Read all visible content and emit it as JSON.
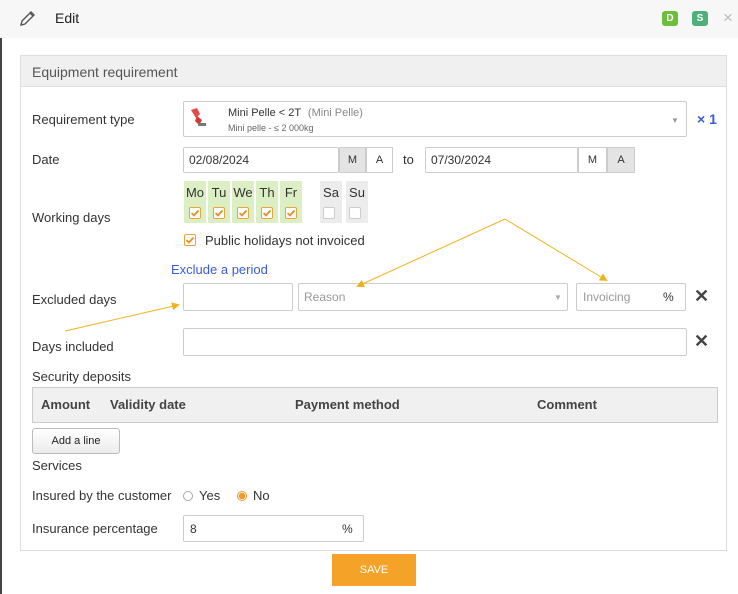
{
  "window": {
    "title": "Edit",
    "badges": [
      {
        "letter": "D",
        "color": "#6cbf3a"
      },
      {
        "letter": "S",
        "color": "#4fb07a"
      }
    ]
  },
  "panel": {
    "title": "Equipment requirement"
  },
  "requirement": {
    "label": "Requirement type",
    "name": "Mini Pelle < 2T",
    "category": "(Mini Pelle)",
    "subtitle": "Mini pelle - ≤ 2 000kg",
    "quantity": "× 1"
  },
  "date": {
    "label": "Date",
    "start": "02/08/2024",
    "end": "07/30/2024",
    "to": "to",
    "seg_m": "M",
    "seg_a": "A"
  },
  "working_days": {
    "label": "Working days",
    "days": [
      {
        "label": "Mo",
        "checked": true
      },
      {
        "label": "Tu",
        "checked": true
      },
      {
        "label": "We",
        "checked": true
      },
      {
        "label": "Th",
        "checked": true
      },
      {
        "label": "Fr",
        "checked": true
      },
      {
        "label": "Sa",
        "checked": false
      },
      {
        "label": "Su",
        "checked": false
      }
    ],
    "holidays_label": "Public holidays not invoiced"
  },
  "excluded": {
    "link": "Exclude a period",
    "label": "Excluded days",
    "reason_placeholder": "Reason",
    "invoicing_placeholder": "Invoicing",
    "percent": "%"
  },
  "days_included": {
    "label": "Days included"
  },
  "security": {
    "label": "Security deposits",
    "columns": [
      "Amount",
      "Validity date",
      "Payment method",
      "Comment"
    ],
    "add_line": "Add a line"
  },
  "services": {
    "label": "Services"
  },
  "insured": {
    "label": "Insured by the customer",
    "yes": "Yes",
    "no": "No",
    "selected": "No"
  },
  "insurance": {
    "label": "Insurance percentage",
    "value": "8",
    "unit": "%"
  },
  "save_label": "SAVE",
  "colors": {
    "accent": "#f5a228",
    "link": "#3a5bd9",
    "day_green": "#dcefc4",
    "day_gray": "#ececec"
  }
}
